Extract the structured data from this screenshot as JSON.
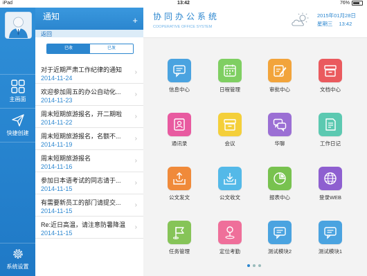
{
  "status_bar": {
    "carrier": "iPad",
    "time": "13:42",
    "battery": "76%"
  },
  "nav": {
    "items": [
      {
        "label": "主画面",
        "icon": "grid-icon"
      },
      {
        "label": "快捷创建",
        "icon": "paper-plane-icon"
      },
      {
        "label": "系统设置",
        "icon": "gear-icon"
      }
    ]
  },
  "list": {
    "title": "通知",
    "add_label": "+",
    "back_label": "返回",
    "segments": [
      "已收",
      "已发"
    ],
    "items": [
      {
        "title": "对于近期严肃工作纪律的通知",
        "date": "2014-11-24"
      },
      {
        "title": "欢迎参加周五的办公自动化...",
        "date": "2014-11-23"
      },
      {
        "title": "周末短期旅游报名，开二期啦",
        "date": "2014-11-22"
      },
      {
        "title": "周末短期旅游报名，名额不...",
        "date": "2014-11-19"
      },
      {
        "title": "周末短期旅游报名",
        "date": "2014-11-16"
      },
      {
        "title": "参加日本语考试的同志请于...",
        "date": "2014-11-15"
      },
      {
        "title": "有需要新员工的部门请提交...",
        "date": "2014-11-15"
      },
      {
        "title": "Re:近日高温，请注意防暑降温",
        "date": "2014-11-15"
      }
    ]
  },
  "header": {
    "title": "协同办公系统",
    "subtitle": "COOPERATIVE OFFICE SYSTEM",
    "date": "2015年01月28日",
    "weekday": "星期三",
    "time": "13:42",
    "weather_icon": "cloud-sun-icon"
  },
  "apps": [
    {
      "label": "信息中心",
      "icon": "message-icon",
      "color": "#4aa3e0"
    },
    {
      "label": "日程管理",
      "icon": "calendar-icon",
      "color": "#7fcf62"
    },
    {
      "label": "审批中心",
      "icon": "edit-icon",
      "color": "#f2a43b"
    },
    {
      "label": "文档中心",
      "icon": "inbox-icon",
      "color": "#ea5a5e"
    },
    {
      "label": "通讯录",
      "icon": "contacts-icon",
      "color": "#e85aa0"
    },
    {
      "label": "会议",
      "icon": "tray-icon",
      "color": "#f4cf3a"
    },
    {
      "label": "华聊",
      "icon": "chat-icon",
      "color": "#9b6fd4"
    },
    {
      "label": "工作日记",
      "icon": "journal-icon",
      "color": "#5cc9b1"
    },
    {
      "label": "公文发文",
      "icon": "upload-icon",
      "color": "#f08a3a"
    },
    {
      "label": "公文收文",
      "icon": "download-icon",
      "color": "#54b9e8"
    },
    {
      "label": "报表中心",
      "icon": "pie-chart-icon",
      "color": "#78c24f"
    },
    {
      "label": "登录WEB",
      "icon": "globe-icon",
      "color": "#8e5fd0"
    },
    {
      "label": "任务管理",
      "icon": "flag-icon",
      "color": "#86c458"
    },
    {
      "label": "定位考勤",
      "icon": "pin-icon",
      "color": "#ef6f9a"
    },
    {
      "label": "测试模块2",
      "icon": "message-icon",
      "color": "#4aa3e0"
    },
    {
      "label": "测试模块1",
      "icon": "message-icon",
      "color": "#4aa3e0"
    }
  ],
  "page_indicator": {
    "pages": 3,
    "current": 1
  }
}
